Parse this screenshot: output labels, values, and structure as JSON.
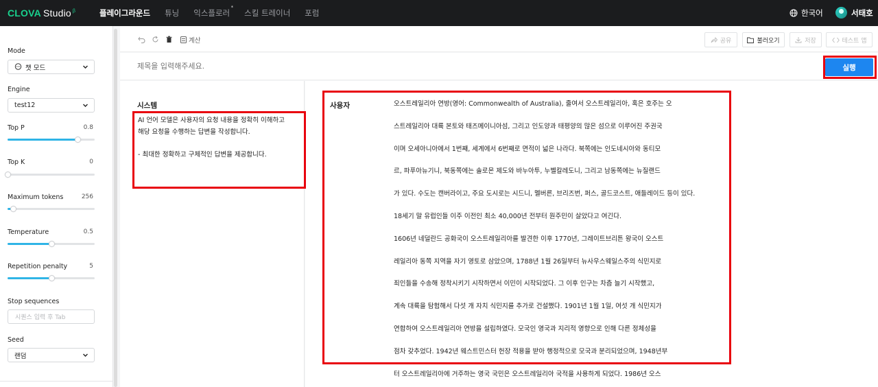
{
  "brand": {
    "clova": "CLOVA",
    "studio": "Studio",
    "beta": "β"
  },
  "nav": {
    "items": [
      {
        "label": "플레이그라운드",
        "active": true
      },
      {
        "label": "튜닝",
        "active": false
      },
      {
        "label": "익스플로러",
        "active": false,
        "star": "*"
      },
      {
        "label": "스킬 트레이너",
        "active": false
      },
      {
        "label": "포럼",
        "active": false
      }
    ],
    "language": "한국어",
    "user_name": "서태호"
  },
  "sidebar": {
    "mode": {
      "label": "Mode",
      "value": "챗 모드"
    },
    "engine": {
      "label": "Engine",
      "value": "test12"
    },
    "top_p": {
      "label": "Top P",
      "value": "0.8",
      "fraction": 0.8
    },
    "top_k": {
      "label": "Top K",
      "value": "0",
      "fraction": 0.0
    },
    "max_tokens": {
      "label": "Maximum tokens",
      "value": "256",
      "fraction": 0.06
    },
    "temperature": {
      "label": "Temperature",
      "value": "0.5",
      "fraction": 0.5
    },
    "repetition_penalty": {
      "label": "Repetition penalty",
      "value": "5",
      "fraction": 0.5
    },
    "stop_sequences": {
      "label": "Stop sequences",
      "placeholder": "시퀀스 입력 후 Tab"
    },
    "seed": {
      "label": "Seed",
      "value": "랜덤"
    }
  },
  "toolbar": {
    "calc_label": "계산",
    "share_label": "공유",
    "load_label": "불러오기",
    "save_label": "저장",
    "test_app_label": "테스트 앱"
  },
  "title_placeholder": "제목을 입력해주세요.",
  "run_label": "실행",
  "system": {
    "label": "시스템",
    "text": "AI 언어 모델은 사용자의 요청 내용을 정확히 이해하고 해당 요청을 수행하는 답변을 작성합니다.\n\n- 최대한 정확하고 구체적인 답변을 제공합니다."
  },
  "user": {
    "label": "사용자",
    "lines": [
      "오스트레일리아 연방(영어: Commonwealth of Australia), 줄여서 오스트레일리아, 혹은 호주는 오",
      "스트레일리아 대륙 본토와 태즈메이니아섬, 그리고 인도양과 태평양의 많은 섬으로 이루어진 주권국",
      "이며 오세아니아에서 1번째, 세계에서 6번째로 면적이 넓은 나라다. 북쪽에는 인도네시아와 동티모",
      "르, 파푸아뉴기니, 북동쪽에는 솔로몬 제도와 바누아투, 누벨칼레도니, 그리고 남동쪽에는 뉴질랜드",
      "가 있다. 수도는 캔버라이고, 주요 도시로는 시드니, 멜버른, 브리즈번, 퍼스, 골드코스트, 애들레이드 등이 있다.",
      "18세기 말 유럽인들 이주 이전인 최소 40,000년 전부터 원주민이 살았다고 여긴다.",
      "1606년 네덜란드 공화국이 오스트레일리아를 발견한 이후 1770년, 그레이트브리튼 왕국이 오스트",
      "레일리아 동쪽 지역을 자기 영토로 삼았으며, 1788년 1월 26일부터 뉴사우스웨일스주의 식민지로",
      "죄인들을 수송해 정착시키기 시작하면서 이민이 시작되었다. 그 이후 인구는 차츰 늘기 시작했고,",
      "계속 대륙을 탐험해서 다섯 개 자치 식민지를 추가로 건설했다. 1901년 1월 1일, 여섯 개 식민지가",
      "연합하여 오스트레일리아 연방을 설립하였다. 모국인 영국과 지리적 영향으로 인해 다른 정체성을",
      "점차 갖추었다. 1942년 웨스트민스터 헌장 적용을 받아 행정적으로 모국과 분리되었으며, 1948년부",
      "터 오스트레일리아에 거주하는 영국 국민은 오스트레일리아 국적을 사용하게 되었다. 1986년 오스"
    ]
  },
  "colors": {
    "accent": "#1d86f0",
    "highlight": "#e8000d",
    "brand_green": "#19d28e",
    "slider": "#2fb4e6"
  }
}
